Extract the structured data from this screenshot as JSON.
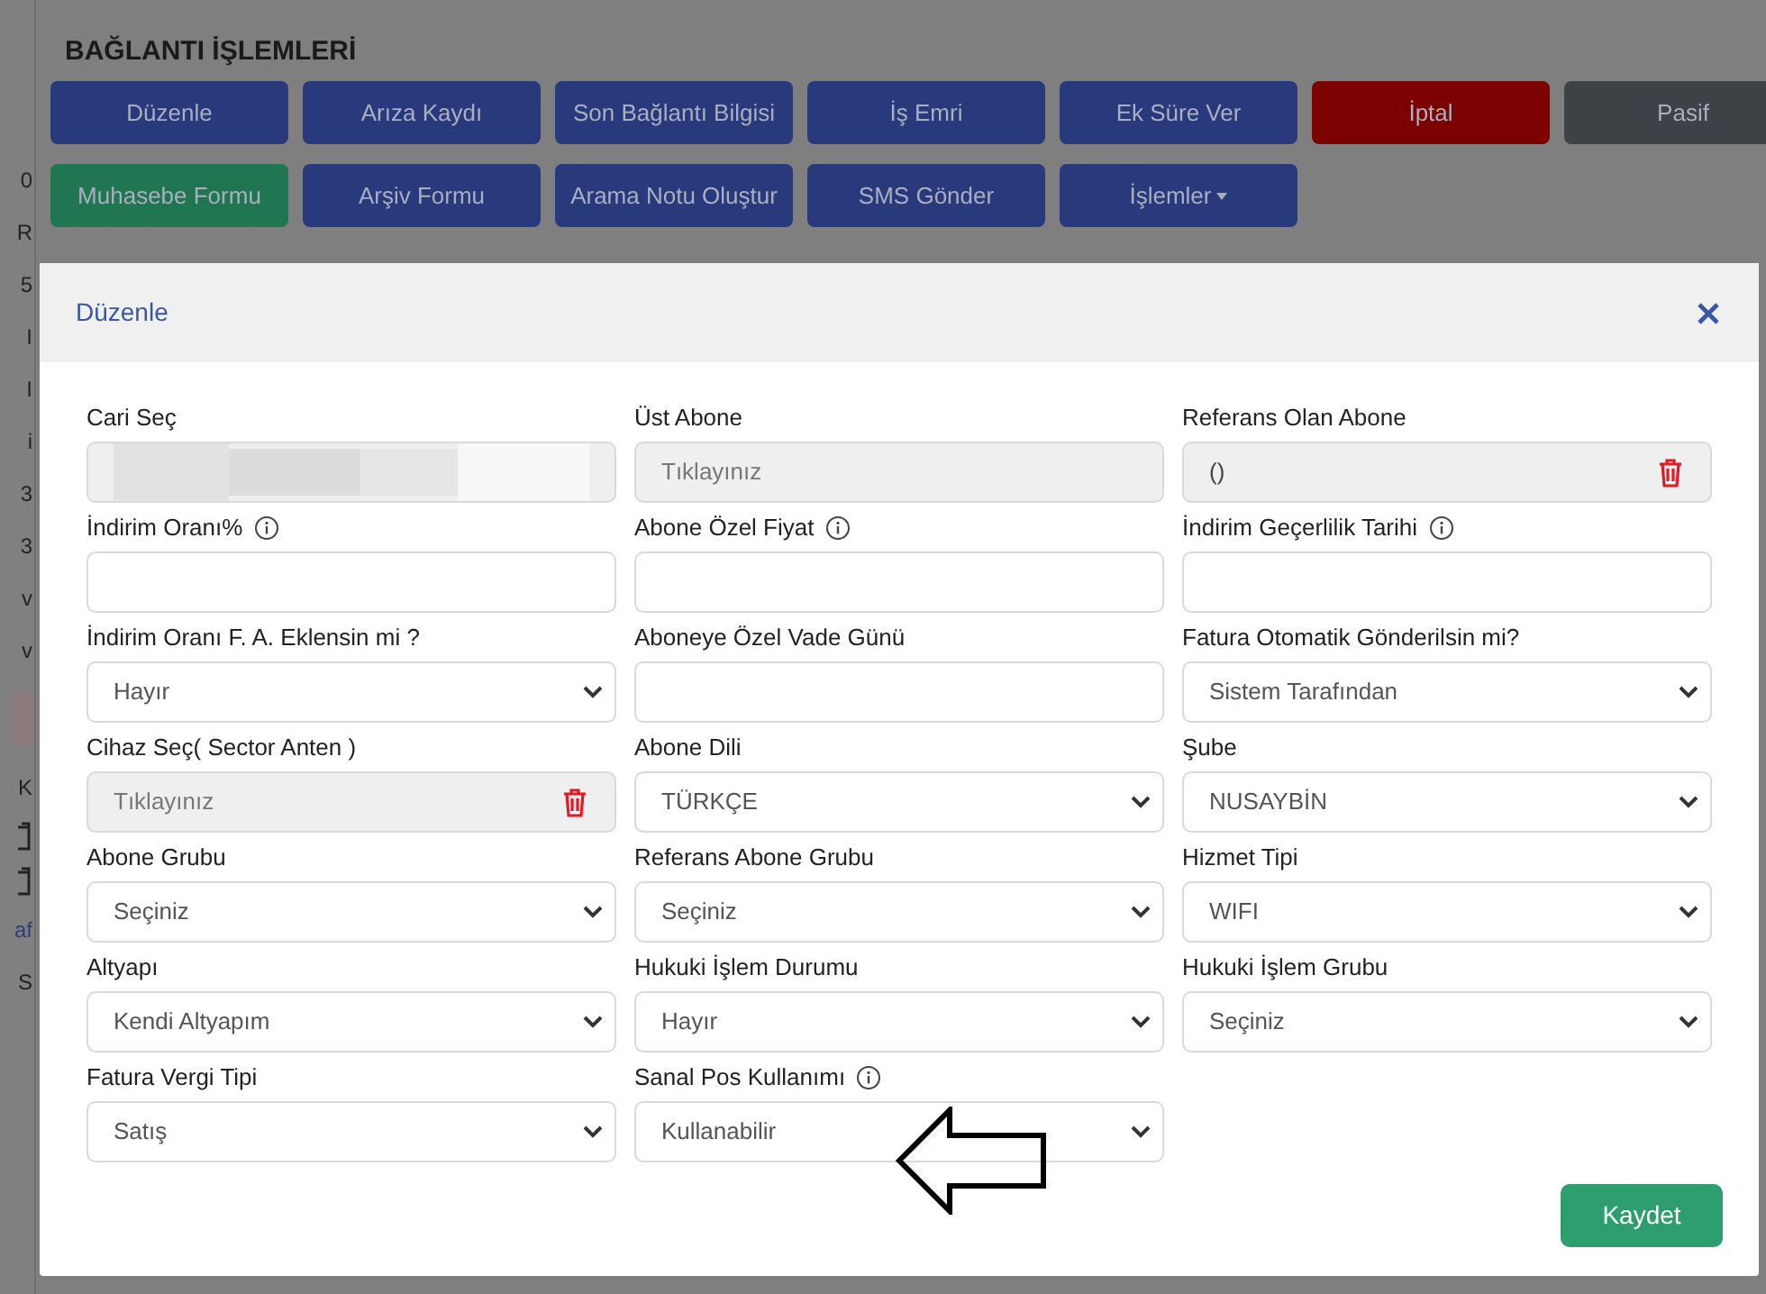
{
  "page": {
    "title": "BAĞLANTI İŞLEMLERİ",
    "button_rows": [
      [
        {
          "label": "Düzenle",
          "color": "#28397c"
        },
        {
          "label": "Arıza Kaydı",
          "color": "#28397c"
        },
        {
          "label": "Son Bağlantı Bilgisi",
          "color": "#28397c"
        },
        {
          "label": "İş Emri",
          "color": "#28397c"
        },
        {
          "label": "Ek Süre Ver",
          "color": "#28397c"
        },
        {
          "label": "İptal",
          "color": "#7c0202"
        },
        {
          "label": "Pasif",
          "color": "#3e4246"
        }
      ],
      [
        {
          "label": "Muhasebe Formu",
          "color": "#1f7650"
        },
        {
          "label": "Arşiv Formu",
          "color": "#28397c"
        },
        {
          "label": "Arama Notu Oluştur",
          "color": "#28397c"
        },
        {
          "label": "SMS Gönder",
          "color": "#28397c"
        },
        {
          "label": "İşlemler",
          "color": "#28397c",
          "dropdown": true
        }
      ]
    ]
  },
  "sidebar_fragments": [
    {
      "kind": "text",
      "text": "0"
    },
    {
      "kind": "text",
      "text": "R"
    },
    {
      "kind": "text",
      "text": "5"
    },
    {
      "kind": "text",
      "text": "I"
    },
    {
      "kind": "text",
      "text": "I"
    },
    {
      "kind": "text",
      "text": "i"
    },
    {
      "kind": "text",
      "text": "3"
    },
    {
      "kind": "text",
      "text": "3"
    },
    {
      "kind": "text",
      "text": "v"
    },
    {
      "kind": "text",
      "text": "v"
    },
    {
      "kind": "highlight"
    },
    {
      "kind": "text",
      "text": "K"
    },
    {
      "kind": "icon"
    },
    {
      "kind": "icon"
    },
    {
      "kind": "link",
      "text": "af"
    },
    {
      "kind": "text",
      "text": "S"
    }
  ],
  "modal": {
    "title": "Düzenle",
    "fields": [
      {
        "label": "Cari Seç",
        "kind": "redacted",
        "info": false,
        "clearable": false
      },
      {
        "label": "Üst Abone",
        "kind": "readonly",
        "placeholder": "Tıklayınız",
        "info": false,
        "clearable": false
      },
      {
        "label": "Referans Olan Abone",
        "kind": "readonly",
        "value": "()",
        "info": false,
        "clearable": true
      },
      {
        "label": "İndirim Oranı%",
        "kind": "text",
        "info": true,
        "clearable": false
      },
      {
        "label": "Abone Özel Fiyat",
        "kind": "text",
        "info": true,
        "clearable": false
      },
      {
        "label": "İndirim Geçerlilik Tarihi",
        "kind": "text",
        "info": true,
        "clearable": false
      },
      {
        "label": "İndirim Oranı F. A. Eklensin mi ?",
        "kind": "select",
        "value": "Hayır",
        "info": false,
        "clearable": false
      },
      {
        "label": "Aboneye Özel Vade Günü",
        "kind": "text",
        "info": false,
        "clearable": false
      },
      {
        "label": "Fatura Otomatik Gönderilsin mi?",
        "kind": "select",
        "value": "Sistem Tarafından",
        "info": false,
        "clearable": false
      },
      {
        "label": "Cihaz Seç( Sector Anten )",
        "kind": "readonly",
        "placeholder": "Tıklayınız",
        "info": false,
        "clearable": true
      },
      {
        "label": "Abone Dili",
        "kind": "select",
        "value": "TÜRKÇE",
        "info": false,
        "clearable": false
      },
      {
        "label": "Şube",
        "kind": "select",
        "value": "NUSAYBİN",
        "info": false,
        "clearable": false
      },
      {
        "label": "Abone Grubu",
        "kind": "select",
        "value": "Seçiniz",
        "info": false,
        "clearable": false
      },
      {
        "label": "Referans Abone Grubu",
        "kind": "select",
        "value": "Seçiniz",
        "info": false,
        "clearable": false
      },
      {
        "label": "Hizmet Tipi",
        "kind": "select",
        "value": "WIFI",
        "info": false,
        "clearable": false
      },
      {
        "label": "Altyapı",
        "kind": "select",
        "value": "Kendi Altyapım",
        "info": false,
        "clearable": false
      },
      {
        "label": "Hukuki İşlem Durumu",
        "kind": "select",
        "value": "Hayır",
        "info": false,
        "clearable": false
      },
      {
        "label": "Hukuki İşlem Grubu",
        "kind": "select",
        "value": "Seçiniz",
        "info": false,
        "clearable": false
      },
      {
        "label": "Fatura Vergi Tipi",
        "kind": "select",
        "value": "Satış",
        "info": false,
        "clearable": false
      },
      {
        "label": "Sanal Pos Kullanımı",
        "kind": "select",
        "value": "Kullanabilir",
        "info": true,
        "clearable": false,
        "pointer": true
      }
    ],
    "save_button": "Kaydet"
  }
}
